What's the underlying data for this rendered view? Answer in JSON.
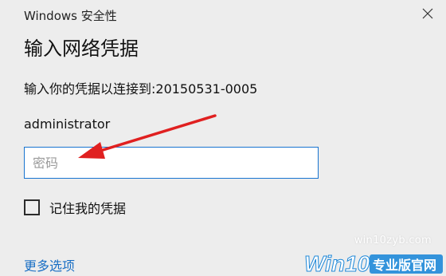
{
  "window": {
    "title": "Windows 安全性",
    "close_icon": "close-icon"
  },
  "dialog": {
    "heading": "输入网络凭据",
    "connect_text": "输入你的凭据以连接到:20150531-0005",
    "username": "administrator",
    "password_placeholder": "密码",
    "password_value": "",
    "remember_label": "记住我的凭据",
    "remember_checked": false,
    "more_options": "更多选项"
  },
  "annotation": {
    "arrow_color": "#e02020"
  },
  "watermark": {
    "url": "win10zyb.com",
    "brand": "Win10专业版官网"
  },
  "colors": {
    "background": "#ededed",
    "accent": "#1874d0",
    "link": "#1a6fc4"
  }
}
